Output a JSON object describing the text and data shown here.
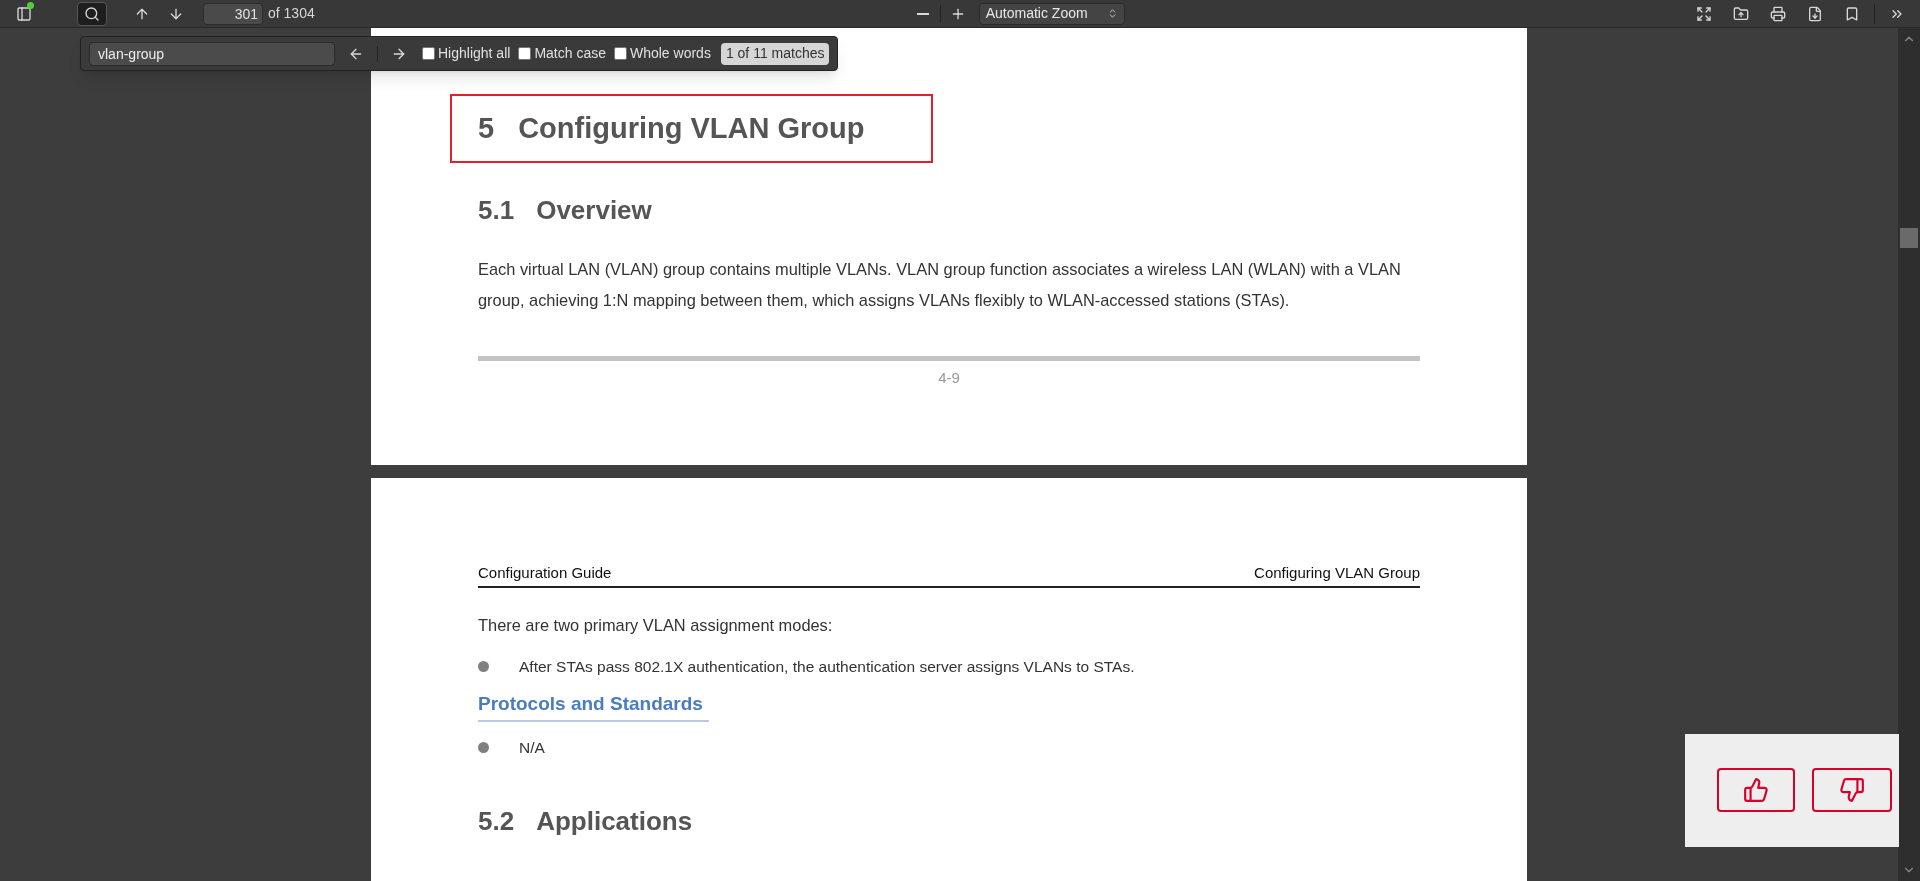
{
  "toolbar": {
    "sidebar_has_notification": true,
    "search_active": true,
    "page_number": "301",
    "page_count": "of 1304",
    "zoom": "Automatic Zoom"
  },
  "find_bar": {
    "query": "vlan-group",
    "options": [
      {
        "label": "Highlight all",
        "checked": false
      },
      {
        "label": "Match case",
        "checked": false
      },
      {
        "label": "Whole words",
        "checked": false
      }
    ],
    "result": "1 of 11 matches"
  },
  "pages": [
    {
      "blocks": [
        {
          "kind": "chapter",
          "number": "5",
          "title": "Configuring VLAN Group",
          "boxed": true
        },
        {
          "kind": "section",
          "number": "5.1",
          "title": "Overview"
        },
        {
          "kind": "paragraph",
          "text": "Each virtual LAN (VLAN) group contains multiple VLANs. VLAN group function associates a wireless LAN (WLAN) with a VLAN group, achieving 1:N mapping between them, which assigns VLANs flexibly to WLAN-accessed stations (STAs)."
        }
      ],
      "footer": "4-9"
    },
    {
      "header_left": "Configuration Guide",
      "header_right": "Configuring VLAN Group",
      "blocks": [
        {
          "kind": "paragraph",
          "text": "There are two primary VLAN assignment modes:"
        },
        {
          "kind": "bullet",
          "text": "After STAs pass 802.1X authentication, the authentication server assigns VLANs to STAs."
        },
        {
          "kind": "subheading",
          "text": "Protocols and Standards"
        },
        {
          "kind": "bullet",
          "text": "N/A"
        },
        {
          "kind": "section",
          "number": "5.2",
          "title": "Applications"
        }
      ]
    }
  ]
}
